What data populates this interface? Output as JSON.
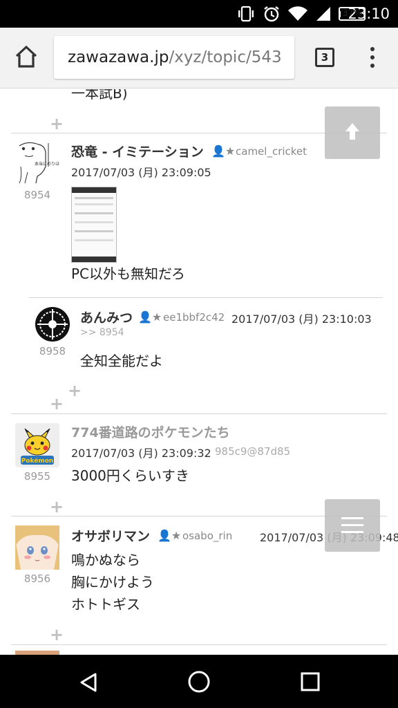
{
  "status": {
    "battery": "37%",
    "time": "23:10"
  },
  "browser": {
    "url_host": "zawazawa.jp",
    "url_path": "/xyz/topic/543",
    "tab_count": "3"
  },
  "posts": [
    {
      "tail_text": "一本試B)"
    },
    {
      "author": "恐竜 - イミテーション",
      "icons": "👤★",
      "uid": "camel_cricket",
      "date": "2017/07/03 (月) 23:09:05",
      "num": "8954",
      "body": "PC以外も無知だろ"
    },
    {
      "author": "あんみつ",
      "icons": "👤★",
      "uid": "ee1bbf2c42",
      "date": "2017/07/03 (月) 23:10:03",
      "reply_to": ">> 8954",
      "num": "8958",
      "body": "全知全能だよ"
    },
    {
      "author": "774番道路のポケモンたち",
      "date": "2017/07/03 (月) 23:09:32",
      "uid": "985c9@87d85",
      "num": "8955",
      "body": "3000円くらいすき"
    },
    {
      "author": "オサボリマン",
      "icons": "👤★",
      "uid": "osabo_rin",
      "date": "2017/07/03 (月) 23:09:48",
      "num": "8956",
      "body": "鳴かぬなら\n胸にかけよう\nホトトギス"
    }
  ],
  "plus_label": "+",
  "avatar_texts": {
    "pokemon_logo": "Pokémon",
    "dino_note": "本当にのりはかわいい"
  },
  "colors": {
    "accent_pikachu": "#f7d02c",
    "status_bg": "#000000",
    "toolbar_bg": "#f2f2f2"
  }
}
